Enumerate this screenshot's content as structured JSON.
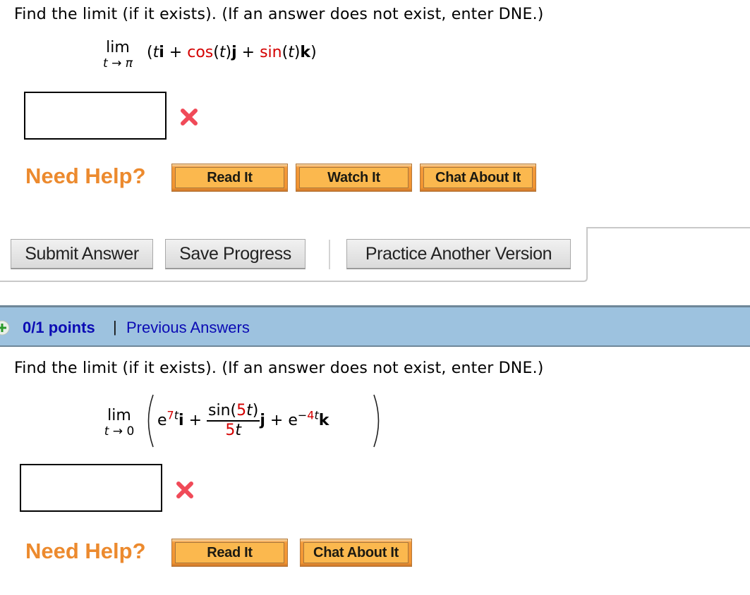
{
  "questions": [
    {
      "prompt": "Find the limit (if it exists). (If an answer does not exist, enter DNE.)",
      "limit": {
        "operator": "lim",
        "subscript_var": "t",
        "subscript_arrow": "→",
        "subscript_target": "π",
        "open_paren": "(",
        "close_paren": ")",
        "t": "t",
        "i": "i",
        "plus1": "+",
        "cos": "cos",
        "cos_arg": "(t)",
        "j": "j",
        "plus2": "+",
        "sin": "sin",
        "sin_arg": "(t)",
        "k": "k"
      },
      "answer_value": "",
      "status_icon": "x-mark-icon",
      "need_help_label": "Need Help?",
      "help_buttons": [
        "Read It",
        "Watch It",
        "Chat About It"
      ]
    },
    {
      "prompt": "Find the limit (if it exists). (If an answer does not exist, enter DNE.)",
      "limit": {
        "operator": "lim",
        "subscript_var": "t",
        "subscript_arrow": "→",
        "subscript_target": "0",
        "e1": "e",
        "exp1_coef": "7",
        "exp1_var": "t",
        "i": "i",
        "plus1": "+",
        "frac_num_fn": "sin(",
        "frac_num_coef": "5",
        "frac_num_var": "t",
        "frac_num_close": ")",
        "frac_den_coef": "5",
        "frac_den_var": "t",
        "j": "j",
        "plus2": "+",
        "e2": "e",
        "exp2_sign": "−",
        "exp2_coef": "4",
        "exp2_var": "t",
        "k": "k"
      },
      "answer_value": "",
      "status_icon": "x-mark-icon",
      "need_help_label": "Need Help?",
      "help_buttons": [
        "Read It",
        "Chat About It"
      ]
    }
  ],
  "actions": {
    "submit_label": "Submit Answer",
    "save_label": "Save Progress",
    "practice_label": "Practice Another Version"
  },
  "score_bar": {
    "points": "0/1 points",
    "separator": "|",
    "previous_answers": "Previous Answers",
    "expand_icon": "plus-circle-icon"
  },
  "colors": {
    "accent_red": "#d40000",
    "help_orange": "#ec8a2e",
    "score_bar_bg": "#9dc2df",
    "link_blue": "#0b0bb4"
  }
}
